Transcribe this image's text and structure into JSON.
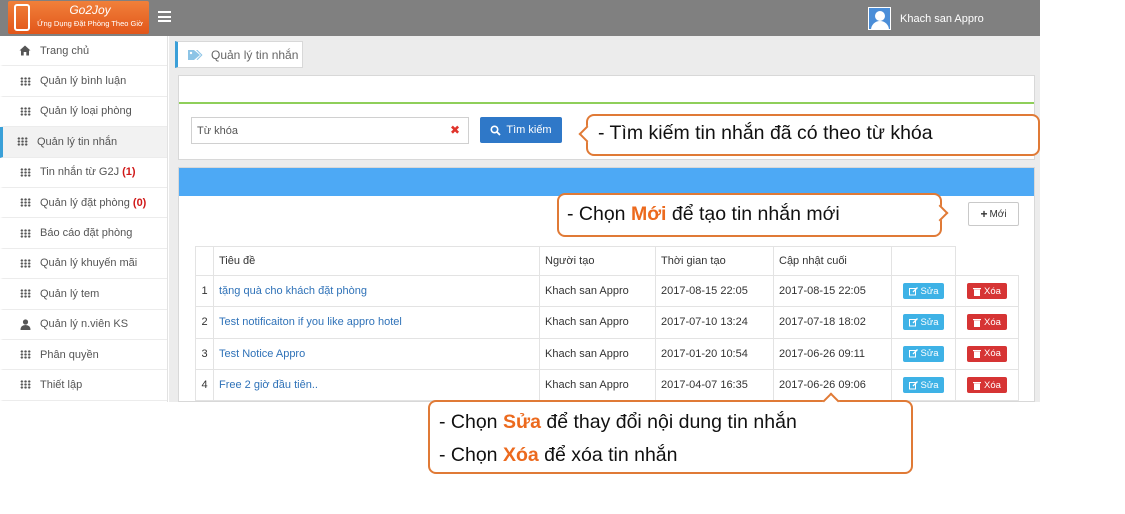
{
  "header": {
    "logo": {
      "brand": "Go2Joy",
      "slogan": "Ứng Dụng Đặt Phòng Theo Giờ"
    },
    "user_name": "Khach san Appro"
  },
  "sidebar": {
    "items": [
      {
        "label": "Trang chủ",
        "icon": "home-icon"
      },
      {
        "label": "Quản lý bình luận",
        "icon": "grid-icon"
      },
      {
        "label": "Quản lý loại phòng",
        "icon": "grid-icon"
      },
      {
        "label": "Quản lý tin nhắn",
        "icon": "grid-icon",
        "active": true
      },
      {
        "label": "Tin nhắn từ G2J",
        "count": "(1)",
        "icon": "grid-icon"
      },
      {
        "label": "Quản lý đặt phòng",
        "count": "(0)",
        "icon": "grid-icon"
      },
      {
        "label": "Báo cáo đặt phòng",
        "icon": "grid-icon"
      },
      {
        "label": "Quản lý khuyến mãi",
        "icon": "grid-icon"
      },
      {
        "label": "Quản lý tem",
        "icon": "grid-icon"
      },
      {
        "label": "Quản lý n.viên KS",
        "icon": "user-icon"
      },
      {
        "label": "Phân quyền",
        "icon": "grid-icon"
      },
      {
        "label": "Thiết lập",
        "icon": "grid-icon"
      }
    ]
  },
  "main": {
    "page_title": "Quản lý tin nhắn",
    "search": {
      "placeholder": "Từ khóa",
      "value": "",
      "button_label": "Tìm kiếm"
    },
    "new_button_label": "Mới",
    "table": {
      "columns": [
        "",
        "Tiêu đề",
        "Người tạo",
        "Thời gian tạo",
        "Cập nhật cuối",
        ""
      ],
      "edit_label": "Sửa",
      "delete_label": "Xóa",
      "rows": [
        {
          "num": "1",
          "title": "tặng quà cho khách đặt phòng",
          "creator": "Khach san Appro",
          "created": "2017-08-15 22:05",
          "updated": "2017-08-15 22:05"
        },
        {
          "num": "2",
          "title": "Test notificaiton if you like appro hotel",
          "creator": "Khach san Appro",
          "created": "2017-07-10 13:24",
          "updated": "2017-07-18 18:02"
        },
        {
          "num": "3",
          "title": "Test Notice Appro",
          "creator": "Khach san Appro",
          "created": "2017-01-20 10:54",
          "updated": "2017-06-26 09:11"
        },
        {
          "num": "4",
          "title": "Free 2 giờ đầu tiên..",
          "creator": "Khach san Appro",
          "created": "2017-04-07 16:35",
          "updated": "2017-06-26 09:06"
        }
      ]
    }
  },
  "callouts": {
    "search": "- Tìm kiếm tin nhắn đã có theo từ khóa",
    "new_pre": "- Chọn ",
    "new_key": "Mới",
    "new_post": " để tạo tin nhắn mới",
    "edit_pre": "- Chọn ",
    "edit_key": "Sửa",
    "edit_post": " để thay đổi nội dung tin nhắn",
    "delete_pre": "- Chọn ",
    "delete_key": "Xóa",
    "delete_post": " để xóa tin nhắn"
  },
  "colors": {
    "topbar": "#808080",
    "accent_blue": "#2f78c8",
    "header_bar": "#4da9f5",
    "edit_button": "#3eb2e6",
    "delete_button": "#d63434",
    "callout_border": "#e07a36",
    "highlight": "#ec6a1e",
    "count_red": "#d01818"
  }
}
